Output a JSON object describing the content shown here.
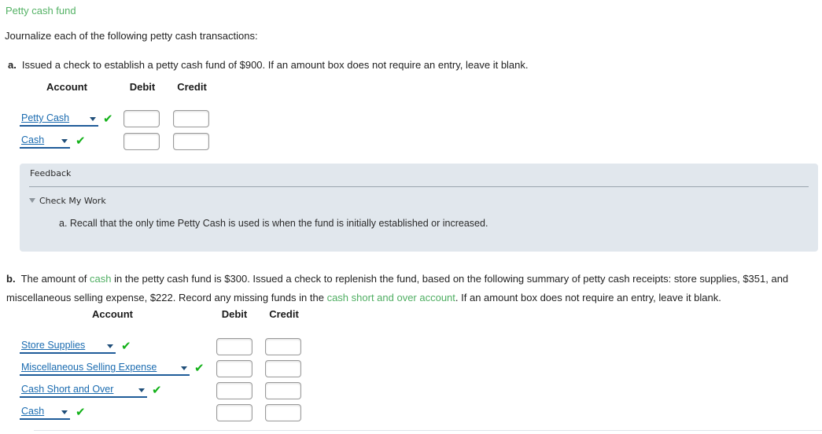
{
  "question": {
    "title": "Petty cash fund",
    "intro": "Journalize each of the following petty cash transactions:"
  },
  "part_a": {
    "label": "a.",
    "prompt": "Issued a check to establish a petty cash fund of $900. If an amount box does not require an entry, leave it blank.",
    "table": {
      "headers": {
        "account": "Account",
        "debit": "Debit",
        "credit": "Credit"
      },
      "rows": [
        {
          "account": "Petty Cash",
          "status": "correct-check",
          "debit": "",
          "credit": "",
          "debit_placeholder": "",
          "credit_placeholder": ""
        },
        {
          "account": "Cash",
          "status": "correct-check",
          "debit": "",
          "credit": "",
          "debit_placeholder": "",
          "credit_placeholder": ""
        }
      ]
    }
  },
  "feedback": {
    "title": "Feedback",
    "check_my_work": "Check My Work",
    "body": "a. Recall that the only time Petty Cash is used is when the fund is initially established or increased."
  },
  "part_b": {
    "label": "b.",
    "prompt_1": "The amount of ",
    "link_1": "cash",
    "prompt_2": " in the petty cash fund is $300. Issued a check to replenish the fund, based on the following summary of petty cash receipts: store supplies, $351, and miscellaneous selling expense, $222. Record any missing funds in the ",
    "link_2": "cash short and over account",
    "prompt_3": ". If an amount box does not require an entry, leave it blank.",
    "table": {
      "headers": {
        "account": "Account",
        "debit": "Debit",
        "credit": "Credit"
      },
      "rows": [
        {
          "account": "Store Supplies",
          "status": "correct-check",
          "debit": "",
          "credit": ""
        },
        {
          "account": "Miscellaneous Selling Expense",
          "status": "correct-check",
          "debit": "",
          "credit": ""
        },
        {
          "account": "Cash Short and Over",
          "status": "correct-check",
          "debit": "",
          "credit": ""
        },
        {
          "account": "Cash",
          "status": "correct-check",
          "debit": "",
          "credit": ""
        }
      ]
    }
  },
  "icons": {
    "check": "✔",
    "dropdown_caret": "caret-down-icon",
    "collapse_triangle": "triangle-down-icon"
  },
  "colors": {
    "title_green": "#54b265",
    "glossary_green": "#4fae62",
    "select_blue": "#1a6bb0",
    "select_underline": "#1f5c99",
    "check_green": "#12b118",
    "feedback_bg": "#e1e7ed"
  }
}
